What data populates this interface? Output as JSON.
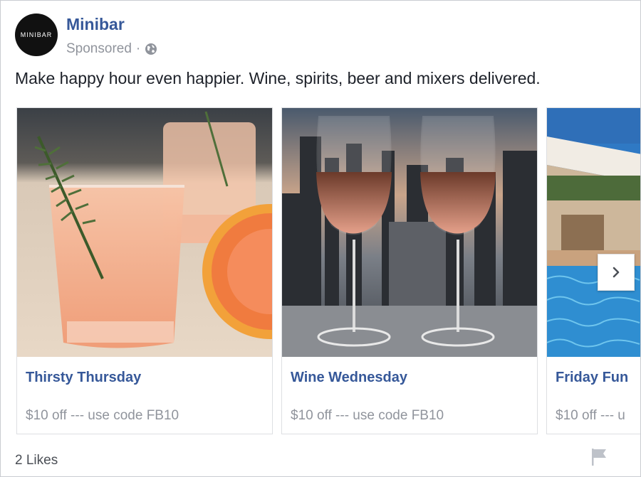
{
  "post": {
    "page_name": "Minibar",
    "avatar_text": "MINIBAR",
    "sponsored": "Sponsored",
    "separator": "·",
    "text": "Make happy hour even happier. Wine, spirits, beer and mixers delivered."
  },
  "carousel": {
    "cards": [
      {
        "title": "Thirsty Thursday",
        "description": "$10 off --- use code FB10",
        "image": "grapefruit-cocktail-with-rosemary"
      },
      {
        "title": "Wine Wednesday",
        "description": "$10 off --- use code FB10",
        "image": "two-wine-glasses-city-skyline"
      },
      {
        "title": "Friday Fun",
        "description": "$10 off --- u",
        "image": "pool-and-building"
      }
    ],
    "next_icon": "chevron-right-icon"
  },
  "footer": {
    "likes": "2 Likes",
    "flag_icon": "flag-icon"
  },
  "colors": {
    "link": "#365899",
    "meta": "#90949c",
    "text": "#1d2129"
  }
}
